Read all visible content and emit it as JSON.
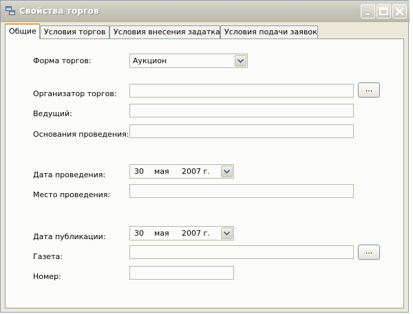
{
  "window": {
    "title": "Свойства торгов"
  },
  "tabs": [
    {
      "label": "Общие",
      "active": true
    },
    {
      "label": "Условия торгов",
      "active": false
    },
    {
      "label": "Условия внесения задатка",
      "active": false
    },
    {
      "label": "Условия подачи заявок",
      "active": false
    }
  ],
  "form": {
    "auction_form": {
      "label": "Форма торгов:",
      "value": "Аукцион"
    },
    "organizer": {
      "label": "Организатор торгов:",
      "value": "",
      "button_label": "..."
    },
    "host": {
      "label": "Ведущий:",
      "value": ""
    },
    "grounds": {
      "label": "Основания проведения:",
      "value": ""
    },
    "event_date": {
      "label": "Дата проведения:",
      "day": "30",
      "month": "мая",
      "year": "2007 г."
    },
    "venue": {
      "label": "Место проведения:",
      "value": ""
    },
    "publication_date": {
      "label": "Дата публикации:",
      "day": "30",
      "month": "мая",
      "year": "2007 г."
    },
    "newspaper": {
      "label": "Газета:",
      "value": "",
      "button_label": "..."
    },
    "number": {
      "label": "Номер:",
      "value": ""
    }
  },
  "icons": {
    "app": "window-icon",
    "minimize": "minimize-icon",
    "maximize": "maximize-icon",
    "close": "close-icon",
    "dropdown": "chevron-down-icon"
  }
}
